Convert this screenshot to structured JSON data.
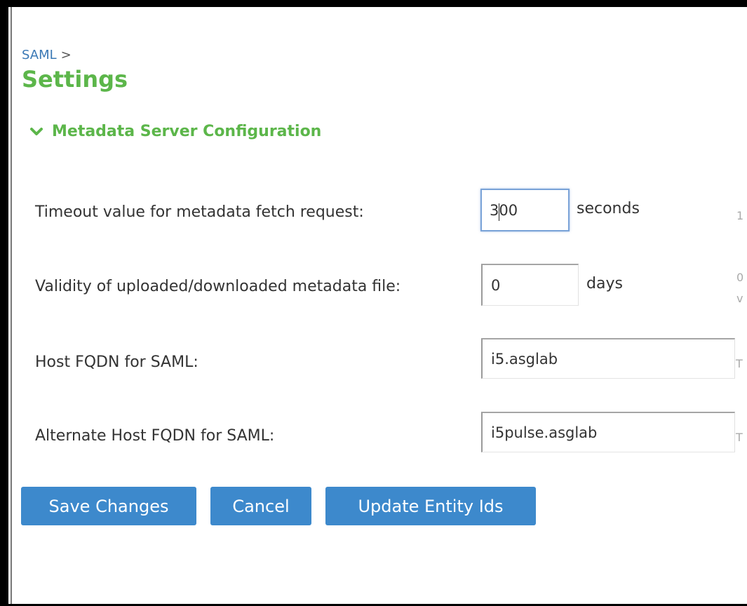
{
  "breadcrumb": {
    "parent": "SAML",
    "separator": ">"
  },
  "page": {
    "title": "Settings"
  },
  "section": {
    "title": "Metadata Server Configuration",
    "expanded": true,
    "toggle_icon": "chevron-down-icon"
  },
  "fields": {
    "timeout": {
      "label": "Timeout value for metadata fetch request:",
      "value": "300",
      "unit": "seconds",
      "hint": "1"
    },
    "validity": {
      "label": "Validity of uploaded/downloaded metadata file:",
      "value": "0",
      "unit": "days",
      "hint_line1": "0",
      "hint_line2": "v"
    },
    "host_fqdn": {
      "label": "Host FQDN for SAML:",
      "value": "i5.asglab",
      "hint": "T"
    },
    "alt_host_fqdn": {
      "label": "Alternate Host FQDN for SAML:",
      "value": "i5pulse.asglab",
      "hint": "T"
    }
  },
  "buttons": {
    "save": "Save Changes",
    "cancel": "Cancel",
    "update_entity_ids": "Update Entity Ids"
  },
  "colors": {
    "title_green": "#5cb64a",
    "link_blue": "#3a78b5",
    "button_blue": "#3d89cc",
    "focus_border": "#7aa3d8"
  }
}
